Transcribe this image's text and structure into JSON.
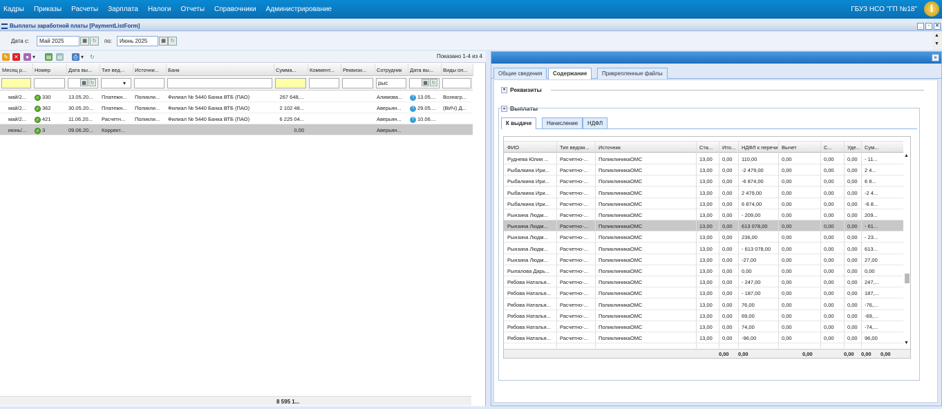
{
  "menu": [
    "Кадры",
    "Приказы",
    "Расчеты",
    "Зарплата",
    "Налоги",
    "Отчеты",
    "Справочники",
    "Администрирование"
  ],
  "org": "ГБУЗ НСО \"ГП №18\"",
  "info_icon": "i",
  "window_title": "Выплаты заработной платы [PaymentListForm]",
  "date_from_label": "Дата с:",
  "date_from": "Май 2025",
  "date_to_label": "по:",
  "date_to": "Июнь 2025",
  "shown": "Показано 1-4 из 4",
  "cols": [
    "Месяц р...",
    "Номер",
    "Дата вы...",
    "Тип вед...",
    "Источни...",
    "Банк",
    "Сумма...",
    "Коммент...",
    "Реквизи...",
    "Сотрудник",
    "Дата вы...",
    "Виды оп..."
  ],
  "filter_employee": "рыс",
  "rows": [
    [
      "май/2...",
      "330",
      "13.05.20...",
      "Платежн...",
      "Поликли...",
      "Филиал № 5440 Банка ВТБ (ПАО)",
      "267 648,...",
      "",
      "",
      "Алимова...",
      "13.05....",
      "Вознагр..."
    ],
    [
      "май/2...",
      "362",
      "30.05.20...",
      "Платежн...",
      "Поликли...",
      "Филиал № 5440 Банка ВТБ (ПАО)",
      "2 102 48...",
      "",
      "",
      "Аверьян...",
      "29.05....",
      "(ВИЧ) Д..."
    ],
    [
      "май/2...",
      "421",
      "11.06.20...",
      "Расчетн...",
      "Поликли...",
      "Филиал № 5440 Банка ВТБ (ПАО)",
      "6 225 04...",
      "",
      "",
      "Аверьян...",
      "10.06....",
      ""
    ],
    [
      "июнь/...",
      "3",
      "09.06.20...",
      "Коррект...",
      "",
      "",
      "0,00",
      "",
      "",
      "Аверьян...",
      "",
      ""
    ]
  ],
  "total": "8 595 1...",
  "tabs": [
    "Общие сведения",
    "Содержание",
    "Прикрепленные файлы"
  ],
  "section_rekv": "Реквизиты",
  "section_vyp": "Выплаты",
  "inner_tabs": [
    "К выдаче",
    "Начисление",
    "НДФЛ"
  ],
  "icols": [
    "ФИО",
    "Тип ведом...",
    "Источник",
    "Ста...",
    "Ито...",
    "НДФЛ к перечисле...",
    "Вычет",
    "С...",
    "Уде...",
    "Сум..."
  ],
  "irows": [
    [
      "Руднева Юлия ...",
      "Расчетно-...",
      "ПоликлиникаОМС",
      "13,00",
      "0,00",
      "110,00",
      "0,00",
      "0,00",
      "0,00",
      "- 11..."
    ],
    [
      "Рыбалкина Ири...",
      "Расчетно-...",
      "ПоликлиникаОМС",
      "13,00",
      "0,00",
      "-2 479,00",
      "0,00",
      "0,00",
      "0,00",
      "2 4..."
    ],
    [
      "Рыбалкина Ири...",
      "Расчетно-...",
      "ПоликлиникаОМС",
      "13,00",
      "0,00",
      "-6 874,00",
      "0,00",
      "0,00",
      "0,00",
      "6 8..."
    ],
    [
      "Рыбалкина Ири...",
      "Расчетно-...",
      "ПоликлиникаОМС",
      "13,00",
      "0,00",
      "2 479,00",
      "0,00",
      "0,00",
      "0,00",
      "-2 4..."
    ],
    [
      "Рыбалкина Ири...",
      "Расчетно-...",
      "ПоликлиникаОМС",
      "13,00",
      "0,00",
      "6 874,00",
      "0,00",
      "0,00",
      "0,00",
      "-6 8..."
    ],
    [
      "Рынзина Людм...",
      "Расчетно-...",
      "ПоликлиникаОМС",
      "13,00",
      "0,00",
      "- 209,00",
      "0,00",
      "0,00",
      "0,00",
      "209..."
    ],
    [
      "Рынзина Людм...",
      "Расчетно-...",
      "ПоликлиникаОМС",
      "13,00",
      "0,00",
      "613 078,00",
      "0,00",
      "0,00",
      "0,00",
      "- 61..."
    ],
    [
      "Рынзина Людм...",
      "Расчетно-...",
      "ПоликлиникаОМС",
      "13,00",
      "0,00",
      "236,00",
      "0,00",
      "0,00",
      "0,00",
      "- 23..."
    ],
    [
      "Рынзина Людм...",
      "Расчетно-...",
      "ПоликлиникаОМС",
      "13,00",
      "0,00",
      "- 613 078,00",
      "0,00",
      "0,00",
      "0,00",
      "613..."
    ],
    [
      "Рынзина Людм...",
      "Расчетно-...",
      "ПоликлиникаОМС",
      "13,00",
      "0,00",
      "-27,00",
      "0,00",
      "0,00",
      "0,00",
      "27,00"
    ],
    [
      "Рыпалова Дарь...",
      "Расчетно-...",
      "ПоликлиникаОМС",
      "13,00",
      "0,00",
      "0,00",
      "0,00",
      "0,00",
      "0,00",
      "0,00"
    ],
    [
      "Рябова Наталья...",
      "Расчетно-...",
      "ПоликлиникаОМС",
      "13,00",
      "0,00",
      "- 247,00",
      "0,00",
      "0,00",
      "0,00",
      "247,..."
    ],
    [
      "Рябова Наталья...",
      "Расчетно-...",
      "ПоликлиникаОМС",
      "13,00",
      "0,00",
      "- 187,00",
      "0,00",
      "0,00",
      "0,00",
      "187,..."
    ],
    [
      "Рябова Наталья...",
      "Расчетно-...",
      "ПоликлиникаОМС",
      "13,00",
      "0,00",
      "76,00",
      "0,00",
      "0,00",
      "0,00",
      "-76,..."
    ],
    [
      "Рябова Наталья...",
      "Расчетно-...",
      "ПоликлиникаОМС",
      "13,00",
      "0,00",
      "69,00",
      "0,00",
      "0,00",
      "0,00",
      "-69,..."
    ],
    [
      "Рябова Наталья...",
      "Расчетно-...",
      "ПоликлиникаОМС",
      "13,00",
      "0,00",
      "74,00",
      "0,00",
      "0,00",
      "0,00",
      "-74,..."
    ],
    [
      "Рябова Наталья...",
      "Расчетно-...",
      "ПоликлиникаОМС",
      "13,00",
      "0,00",
      "-96,00",
      "0,00",
      "0,00",
      "0,00",
      "96,00"
    ]
  ],
  "itotals": [
    "0,00",
    "0,00",
    "0,00",
    "0,00",
    "0,00",
    "0,00"
  ]
}
